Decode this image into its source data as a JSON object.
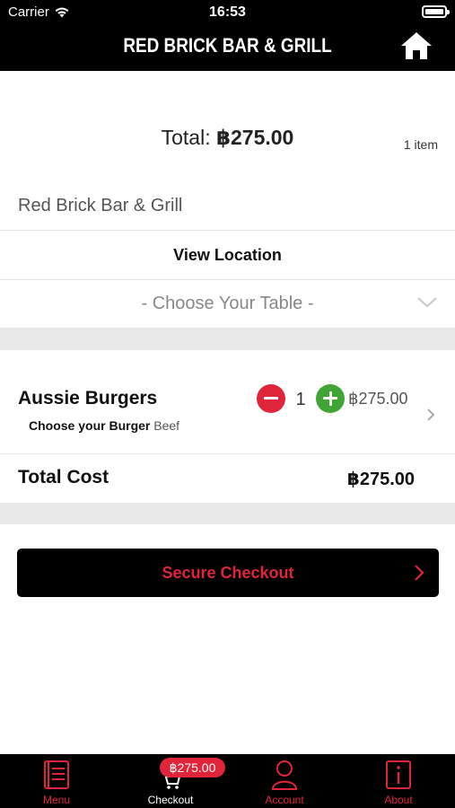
{
  "status_bar": {
    "carrier": "Carrier",
    "time": "16:53"
  },
  "header": {
    "title": "RED BRICK BAR & GRILL",
    "home_icon": "home-icon"
  },
  "summary": {
    "total_label": "Total:",
    "total_amount": "฿275.00",
    "item_count": "1 item"
  },
  "venue": {
    "name": "Red Brick Bar & Grill",
    "view_location_label": "View Location",
    "table_placeholder": "- Choose Your Table -"
  },
  "cart": {
    "items": [
      {
        "name": "Aussie Burgers",
        "option_label": "Choose your Burger",
        "option_value": "Beef",
        "quantity": "1",
        "price": "฿275.00"
      }
    ],
    "total_cost_label": "Total Cost",
    "total_cost_value": "฿275.00"
  },
  "checkout_button": {
    "label": "Secure Checkout"
  },
  "tabbar": {
    "tabs": [
      {
        "label": "Menu",
        "icon": "menu-book-icon"
      },
      {
        "label": "Checkout",
        "icon": "cart-icon",
        "badge": "฿275.00",
        "active": true
      },
      {
        "label": "Account",
        "icon": "account-icon"
      },
      {
        "label": "About",
        "icon": "info-icon"
      }
    ]
  },
  "colors": {
    "accent_red": "#e0243a",
    "plus_green": "#3fa635",
    "bar_black": "#000000",
    "section_gray": "#e8e8e8"
  }
}
